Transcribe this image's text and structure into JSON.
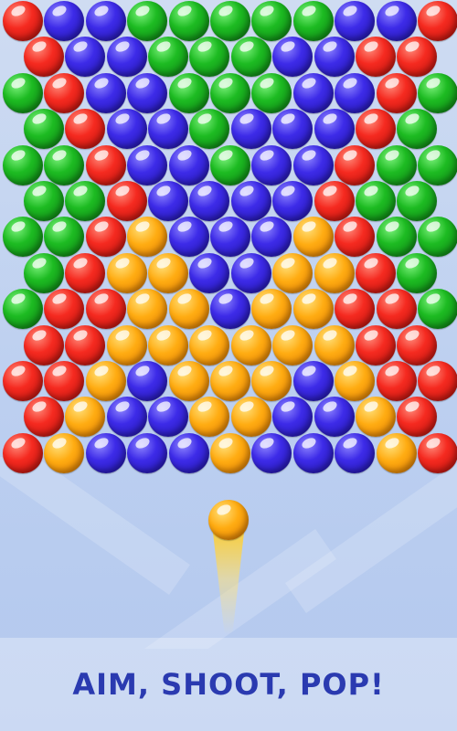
{
  "tagline": "AIM, SHOOT, POP!",
  "colors": {
    "red": "#f52a20",
    "blue": "#3d2be8",
    "green": "#1dbb22",
    "orange": "#ffac12",
    "tagline_text": "#2a3ab0"
  },
  "shooter": {
    "color": "orange"
  },
  "grid": {
    "rows": [
      [
        "red",
        "blue",
        "blue",
        "green",
        "green",
        "green",
        "green",
        "green",
        "blue",
        "blue",
        "red"
      ],
      [
        "red",
        "blue",
        "blue",
        "green",
        "green",
        "green",
        "blue",
        "blue",
        "red",
        "red"
      ],
      [
        "green",
        "red",
        "blue",
        "blue",
        "green",
        "green",
        "green",
        "blue",
        "blue",
        "red",
        "green"
      ],
      [
        "green",
        "red",
        "blue",
        "blue",
        "green",
        "blue",
        "blue",
        "blue",
        "red",
        "green"
      ],
      [
        "green",
        "green",
        "red",
        "blue",
        "blue",
        "green",
        "blue",
        "blue",
        "red",
        "green",
        "green"
      ],
      [
        "green",
        "green",
        "red",
        "blue",
        "blue",
        "blue",
        "blue",
        "red",
        "green",
        "green"
      ],
      [
        "green",
        "green",
        "red",
        "orange",
        "blue",
        "blue",
        "blue",
        "orange",
        "red",
        "green",
        "green"
      ],
      [
        "green",
        "red",
        "orange",
        "orange",
        "blue",
        "blue",
        "orange",
        "orange",
        "red",
        "green"
      ],
      [
        "green",
        "red",
        "red",
        "orange",
        "orange",
        "blue",
        "orange",
        "orange",
        "red",
        "red",
        "green"
      ],
      [
        "red",
        "red",
        "orange",
        "orange",
        "orange",
        "orange",
        "orange",
        "orange",
        "red",
        "red"
      ],
      [
        "red",
        "red",
        "orange",
        "blue",
        "orange",
        "orange",
        "orange",
        "blue",
        "orange",
        "red",
        "red"
      ],
      [
        "red",
        "orange",
        "blue",
        "blue",
        "orange",
        "orange",
        "blue",
        "blue",
        "orange",
        "red"
      ],
      [
        "red",
        "orange",
        "blue",
        "blue",
        "blue",
        "orange",
        "blue",
        "blue",
        "blue",
        "orange",
        "red"
      ]
    ]
  }
}
